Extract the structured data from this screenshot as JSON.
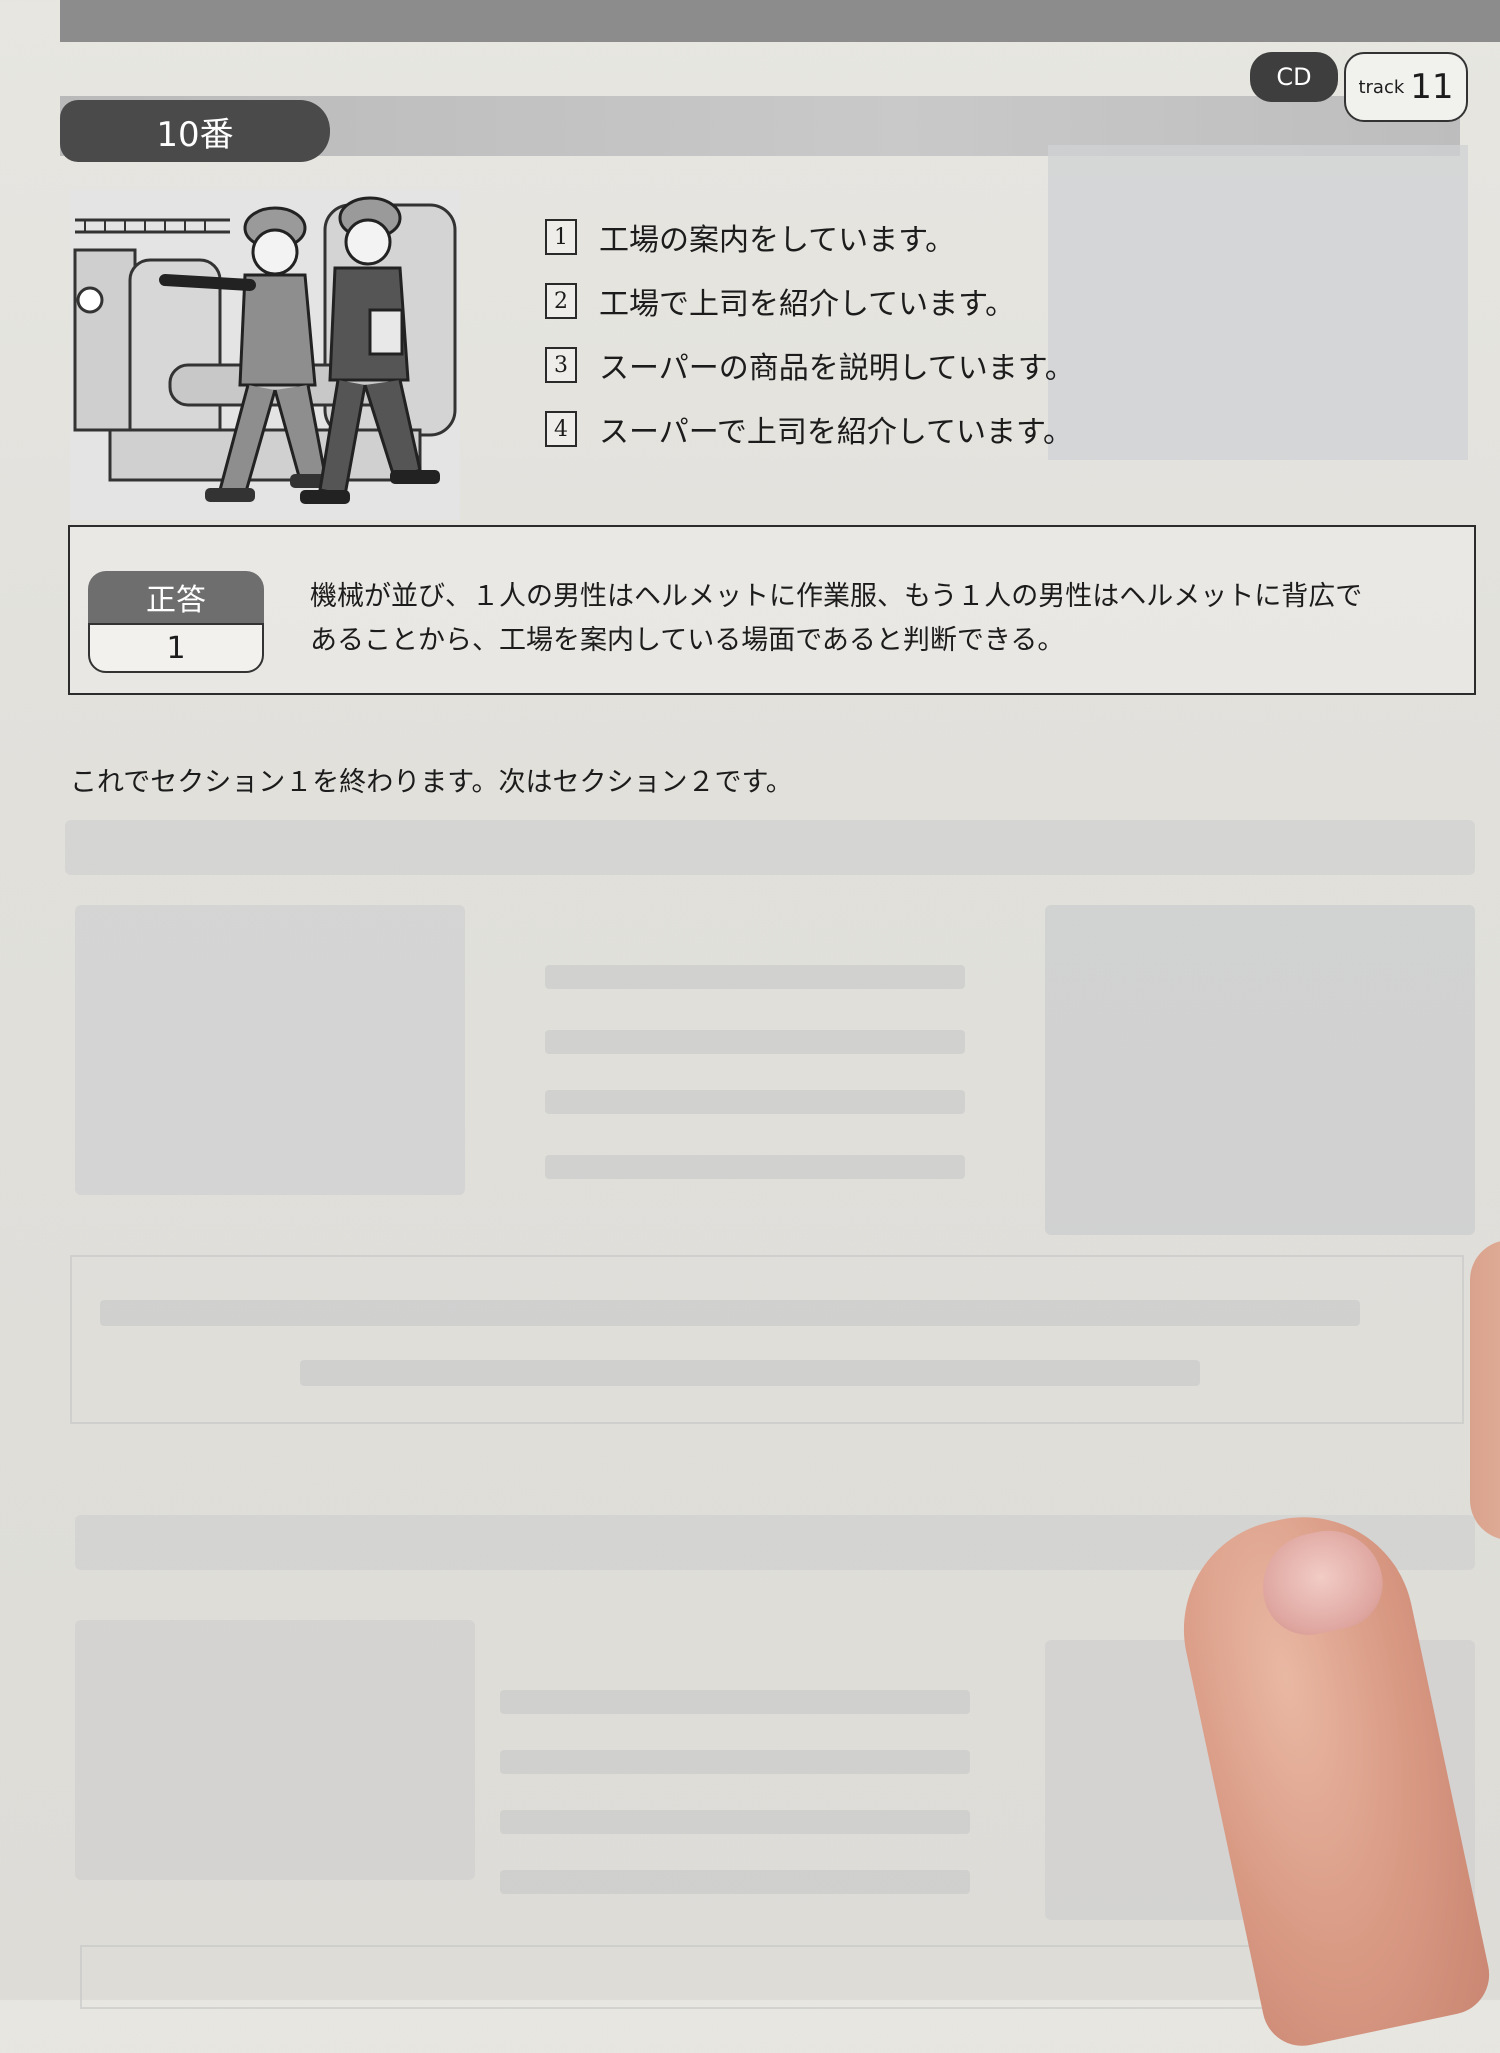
{
  "header": {
    "question_label": "10番",
    "cd_label": "CD",
    "track_prefix": "track",
    "track_number": "11"
  },
  "options": [
    {
      "number": "1",
      "text": "工場の案内をしています。"
    },
    {
      "number": "2",
      "text": "工場で上司を紹介しています。"
    },
    {
      "number": "3",
      "text": "スーパーの商品を説明しています。"
    },
    {
      "number": "4",
      "text": "スーパーで上司を紹介しています。"
    }
  ],
  "answer": {
    "label": "正答",
    "value": "1",
    "explanation_line1": "機械が並び、１人の男性はヘルメットに作業服、もう１人の男性はヘルメットに背広で",
    "explanation_line2": "あることから、工場を案内している場面であると判断できる。"
  },
  "section_end": "これでセクション１を終わります。次はセクション２です。",
  "illustration": {
    "icon": "two-workers-with-helmets-in-factory-illustration"
  }
}
